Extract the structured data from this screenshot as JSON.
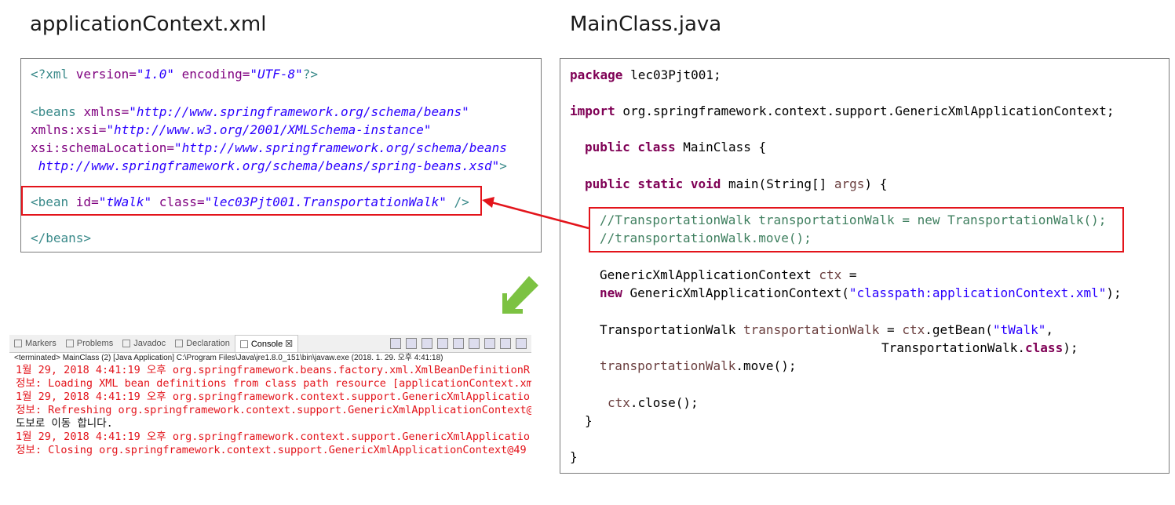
{
  "left_title": "applicationContext.xml",
  "right_title": "MainClass.java",
  "xml": {
    "decl": {
      "open": "<?xml ",
      "attr1": "version=",
      "val1": "\"1.0\"",
      "attr2": " encoding=",
      "val2": "\"UTF-8\"",
      "close": "?>"
    },
    "beans1": {
      "open": "<beans ",
      "attr": "xmlns=",
      "val": "\"http://www.springframework.org/schema/beans\""
    },
    "beans2": {
      "attr": "xmlns:xsi=",
      "val": "\"http://www.w3.org/2001/XMLSchema-instance\""
    },
    "beans3": {
      "attr": "xsi:schemaLocation=",
      "val": "\"http://www.springframework.org/schema/beans"
    },
    "beans4": {
      "val": " http://www.springframework.org/schema/beans/spring-beans.xsd\"",
      "close": ">"
    },
    "bean": {
      "open": "<bean ",
      "attr1": "id=",
      "val1": "\"tWalk\"",
      "attr2": " class=",
      "val2": "\"lec03Pjt001.TransportationWalk\"",
      "close": " />"
    },
    "end": "</beans>"
  },
  "java": {
    "l1_kw": "package",
    "l1_rest": " lec03Pjt001;",
    "l2_kw": "import",
    "l2_rest": " org.springframework.context.support.GenericXmlApplicationContext;",
    "l3_kw": "public class",
    "l3_rest": " MainClass {",
    "l4_kw": "public static void",
    "l4_rest": " main(String[] ",
    "l4_arg": "args",
    "l4_end": ") {",
    "c1": "//TransportationWalk transportationWalk = new TransportationWalk();",
    "c2": "//transportationWalk.move();",
    "l5a": "GenericXmlApplicationContext ",
    "l5b": "ctx",
    "l5c": " =",
    "l6_kw": "new",
    "l6a": " GenericXmlApplicationContext(",
    "l6_str": "\"classpath:applicationContext.xml\"",
    "l6b": ");",
    "l7a": "TransportationWalk ",
    "l7b": "transportationWalk",
    "l7c": " = ",
    "l7d": "ctx",
    "l7e": ".getBean(",
    "l7_str": "\"tWalk\"",
    "l7f": ",",
    "l8a": "TransportationWalk.",
    "l8_kw": "class",
    "l8b": ");",
    "l9a": "transportationWalk",
    "l9b": ".move();",
    "l10a": "ctx",
    "l10b": ".close();",
    "close1": "}",
    "close2": "}"
  },
  "console": {
    "tabs": [
      {
        "label": "Markers",
        "icon": "markers-icon"
      },
      {
        "label": "Problems",
        "icon": "problems-icon"
      },
      {
        "label": "Javadoc",
        "icon": "javadoc-icon"
      },
      {
        "label": "Declaration",
        "icon": "declaration-icon"
      },
      {
        "label": "Console ☒",
        "icon": "console-icon"
      }
    ],
    "status": "<terminated> MainClass (2) [Java Application] C:\\Program Files\\Java\\jre1.8.0_151\\bin\\javaw.exe (2018. 1. 29. 오후 4:41:18)",
    "lines": [
      {
        "text": "1월 29, 2018 4:41:19 오후 org.springframework.beans.factory.xml.XmlBeanDefinitionR",
        "color": "r"
      },
      {
        "text": "정보: Loading XML bean definitions from class path resource [applicationContext.xm",
        "color": "r"
      },
      {
        "text": "1월 29, 2018 4:41:19 오후 org.springframework.context.support.GenericXmlApplicatio",
        "color": "r"
      },
      {
        "text": "정보: Refreshing org.springframework.context.support.GenericXmlApplicationContext@",
        "color": "r"
      },
      {
        "text": "도보로 이동 합니다.",
        "color": "b"
      },
      {
        "text": "1월 29, 2018 4:41:19 오후 org.springframework.context.support.GenericXmlApplicatio",
        "color": "r"
      },
      {
        "text": "정보: Closing org.springframework.context.support.GenericXmlApplicationContext@49",
        "color": "r"
      }
    ]
  },
  "colors": {
    "highlight_box": "#e3141b",
    "arrow_green": "#7cc242"
  }
}
